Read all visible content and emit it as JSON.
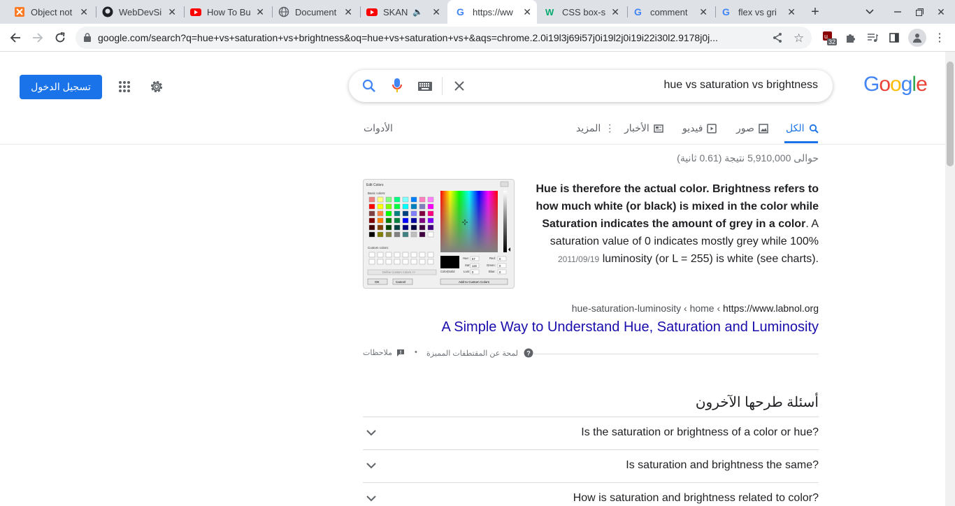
{
  "browser": {
    "tabs": [
      {
        "title": "Object not",
        "icon": "xampp-icon",
        "color": "#fb7a24"
      },
      {
        "title": "WebDevSi",
        "icon": "github-icon",
        "color": "#202124"
      },
      {
        "title": "How To Bu",
        "icon": "youtube-icon",
        "color": "#ff0000"
      },
      {
        "title": "Document",
        "icon": "globe-icon",
        "color": "#5f6368"
      },
      {
        "title": "SKAN",
        "icon": "youtube-icon",
        "color": "#ff0000"
      },
      {
        "title": "https://ww",
        "icon": "google-icon",
        "color": "#4285f4"
      },
      {
        "title": "CSS box-s",
        "icon": "w3schools-icon",
        "color": "#04aa6d"
      },
      {
        "title": "comment",
        "icon": "google-icon",
        "color": "#4285f4"
      },
      {
        "title": "flex vs gri",
        "icon": "google-icon",
        "color": "#4285f4"
      }
    ],
    "url": "google.com/search?q=hue+vs+saturation+vs+brightness&oq=hue+vs+saturation+vs+&aqs=chrome.2.0i19l3j69i57j0i19l2j0i19i22i30l2.9178j0j...",
    "extension_badge": "32"
  },
  "header": {
    "signin_label": "تسجيل الدخول",
    "query": "hue vs saturation vs brightness",
    "logo": [
      "G",
      "o",
      "o",
      "g",
      "l",
      "e"
    ],
    "logo_colors": [
      "#4285f4",
      "#ea4335",
      "#fbbc05",
      "#4285f4",
      "#34a853",
      "#ea4335"
    ]
  },
  "nav": {
    "all": "الكل",
    "images": "صور",
    "videos": "فيديو",
    "news": "الأخبار",
    "more": "المزيد",
    "tools": "الأدوات"
  },
  "results": {
    "stats": "حوالى 5,910,000 نتيجة (0.61 ثانية)",
    "snippet_bold": "Hue is therefore the actual color. Brightness refers to how much white (or black) is mixed in the color while Saturation indicates the amount of grey in a color",
    "snippet_rest": ". A saturation value of 0 indicates mostly grey while 100% luminosity (or L = 255) is white (see charts).",
    "snippet_date": "2011/09/19",
    "cite_domain": "https://www.labnol.org",
    "cite_path": "hue-saturation-luminosity ‹ home ‹ ",
    "title": "A Simple Way to Understand Hue, Saturation and Luminosity",
    "featured_about": "لمحة عن المقتطفات المميزة",
    "feedback": "ملاحظات",
    "featured_dot": "•"
  },
  "paa": {
    "title": "أسئلة طرحها الآخرون",
    "questions": [
      "Is the saturation or brightness of a color or hue?",
      "Is saturation and brightness the same?",
      "How is saturation and brightness related to color?"
    ]
  },
  "dialog_thumb": {
    "title": "Edit Colors",
    "basic": "Basic colors:",
    "custom": "Custom colors:",
    "define": "Define Custom Colors >>",
    "ok": "OK",
    "cancel": "Cancel",
    "add": "Add to Custom Colors",
    "solid": "Color|Solid",
    "hue": "Hue:",
    "sat": "Sat:",
    "lum": "Lum:",
    "red": "Red:",
    "green": "Green:",
    "blue": "Blue:",
    "hue_v": "57",
    "sat_v": "122",
    "lum_v": "0",
    "red_v": "0",
    "green_v": "0",
    "blue_v": "0"
  }
}
